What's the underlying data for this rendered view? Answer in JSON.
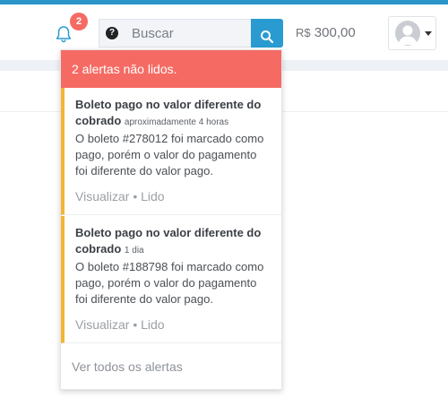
{
  "navbar": {
    "notifications_count": "2",
    "search": {
      "placeholder": "Buscar",
      "help_icon_text": "?"
    },
    "balance": {
      "currency": "R$",
      "amount": "300,00"
    }
  },
  "alerts_dropdown": {
    "header": "2 alertas não lidos.",
    "items": [
      {
        "title": "Boleto pago no valor diferente do cobrado",
        "time": "aproximadamente 4 horas",
        "body": "O boleto #278012 foi marcado como pago, porém o valor do pagamento foi diferente do valor pago.",
        "view_label": "Visualizar",
        "separator": "•",
        "read_label": "Lido"
      },
      {
        "title": "Boleto pago no valor diferente do cobrado",
        "time": "1 dia",
        "body": "O boleto #188798 foi marcado como pago, porém o valor do pagamento foi diferente do valor pago.",
        "view_label": "Visualizar",
        "separator": "•",
        "read_label": "Lido"
      }
    ],
    "footer": "Ver todos os alertas"
  },
  "colors": {
    "brand_blue": "#2a95c8",
    "alert_red": "#f56b64",
    "unread_accent": "#f5b431"
  },
  "icons": {
    "bell": "bell-icon",
    "search": "search-icon",
    "help": "help-icon",
    "avatar": "user-avatar-icon",
    "caret": "caret-down-icon"
  }
}
